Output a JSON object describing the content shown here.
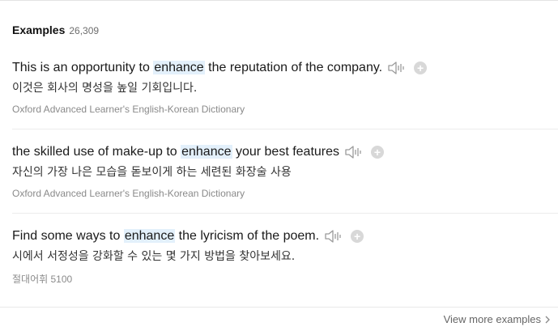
{
  "header": {
    "title": "Examples",
    "count": "26,309"
  },
  "examples": [
    {
      "before": "This is an opportunity to ",
      "highlight": "enhance",
      "after": " the reputation of the company.",
      "translation": "이것은 회사의 명성을 높일 기회입니다.",
      "source": "Oxford Advanced Learner's English-Korean Dictionary"
    },
    {
      "before": "the skilled use of make-up to ",
      "highlight": "enhance",
      "after": " your best features",
      "translation": "자신의 가장 나은 모습을 돋보이게 하는 세련된 화장술 사용",
      "source": "Oxford Advanced Learner's English-Korean Dictionary"
    },
    {
      "before": "Find some ways to ",
      "highlight": "enhance",
      "after": " the lyricism of the poem.",
      "translation": "시에서 서정성을 강화할 수 있는 몇 가지 방법을 찾아보세요.",
      "source": "절대어휘 5100"
    }
  ],
  "icons": {
    "speaker": "speaker-icon",
    "add": "plus-circle-icon",
    "chevron": "chevron-right-icon"
  },
  "plus_glyph": "+",
  "footer": {
    "view_more": "View more examples"
  },
  "colors": {
    "highlight": "#e3f0fb",
    "icon_gray": "#9a9a9a",
    "plus_bg": "#d8d8d8"
  }
}
